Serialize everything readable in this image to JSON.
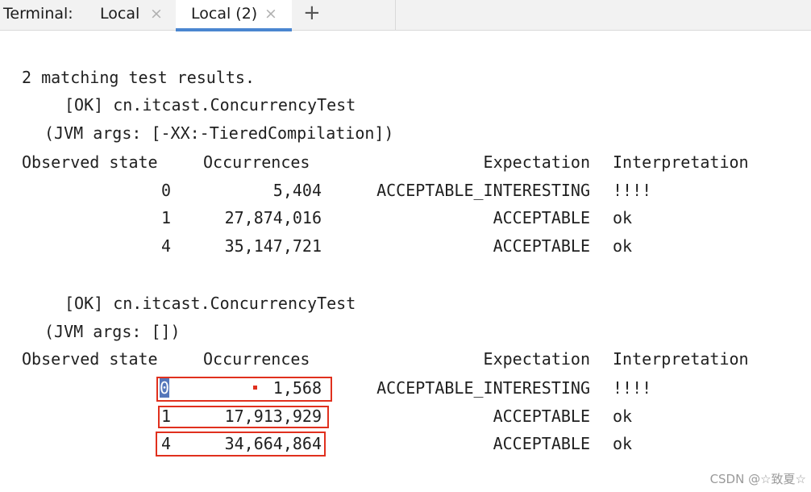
{
  "tabbar": {
    "label": "Terminal:",
    "tabs": [
      {
        "label": "Local",
        "close": "×"
      },
      {
        "label": "Local (2)",
        "close": "×"
      }
    ],
    "add": "+"
  },
  "output": {
    "summary": "2 matching test results.",
    "results": [
      {
        "ok_line": "[OK] cn.itcast.ConcurrencyTest",
        "jvm_line": "(JVM args: [-XX:-TieredCompilation])",
        "headers": [
          "Observed state",
          "Occurrences",
          "Expectation",
          "Interpretation"
        ],
        "rows": [
          {
            "state": "0",
            "occurrences": "5,404",
            "expectation": "ACCEPTABLE_INTERESTING",
            "interpretation": "!!!!"
          },
          {
            "state": "1",
            "occurrences": "27,874,016",
            "expectation": "ACCEPTABLE",
            "interpretation": "ok"
          },
          {
            "state": "4",
            "occurrences": "35,147,721",
            "expectation": "ACCEPTABLE",
            "interpretation": "ok"
          }
        ]
      },
      {
        "ok_line": "[OK] cn.itcast.ConcurrencyTest",
        "jvm_line": "(JVM args: [])",
        "headers": [
          "Observed state",
          "Occurrences",
          "Expectation",
          "Interpretation"
        ],
        "rows": [
          {
            "state": "0",
            "occurrences": "1,568",
            "expectation": "ACCEPTABLE_INTERESTING",
            "interpretation": "!!!!"
          },
          {
            "state": "1",
            "occurrences": "17,913,929",
            "expectation": "ACCEPTABLE",
            "interpretation": "ok"
          },
          {
            "state": "4",
            "occurrences": "34,664,864",
            "expectation": "ACCEPTABLE",
            "interpretation": "ok"
          }
        ]
      }
    ]
  },
  "colors": {
    "highlight_box": "#e0301e",
    "tab_underline": "#4a86d0"
  },
  "watermark": "CSDN @☆致夏☆"
}
